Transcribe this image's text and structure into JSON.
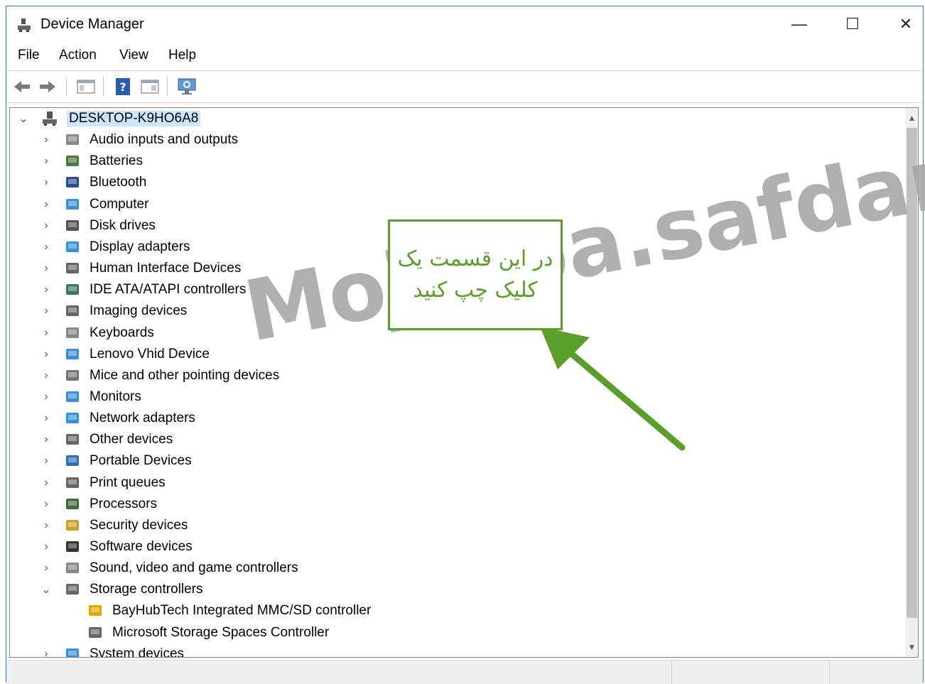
{
  "window": {
    "title": "Device Manager",
    "controls": {
      "minimize": "—",
      "maximize": "☐",
      "close": "✕"
    }
  },
  "menu": [
    "File",
    "Action",
    "View",
    "Help"
  ],
  "toolbar": {
    "buttons": [
      "back-icon",
      "forward-icon",
      "properties-pane-icon",
      "help-icon",
      "update-driver-icon",
      "scan-hardware-icon"
    ]
  },
  "tree": {
    "root": "DESKTOP-K9HO6A8",
    "categories": [
      {
        "label": "Audio inputs and outputs",
        "icon": "speaker-icon",
        "expanded": false
      },
      {
        "label": "Batteries",
        "icon": "battery-icon",
        "expanded": false
      },
      {
        "label": "Bluetooth",
        "icon": "bluetooth-icon",
        "expanded": false
      },
      {
        "label": "Computer",
        "icon": "computer-icon",
        "expanded": false
      },
      {
        "label": "Disk drives",
        "icon": "disk-drive-icon",
        "expanded": false
      },
      {
        "label": "Display adapters",
        "icon": "display-adapter-icon",
        "expanded": false
      },
      {
        "label": "Human Interface Devices",
        "icon": "hid-icon",
        "expanded": false
      },
      {
        "label": "IDE ATA/ATAPI controllers",
        "icon": "ide-controller-icon",
        "expanded": false
      },
      {
        "label": "Imaging devices",
        "icon": "camera-icon",
        "expanded": false
      },
      {
        "label": "Keyboards",
        "icon": "keyboard-icon",
        "expanded": false
      },
      {
        "label": "Lenovo Vhid Device",
        "icon": "network-computer-icon",
        "expanded": false
      },
      {
        "label": "Mice and other pointing devices",
        "icon": "mouse-icon",
        "expanded": false
      },
      {
        "label": "Monitors",
        "icon": "monitor-icon",
        "expanded": false
      },
      {
        "label": "Network adapters",
        "icon": "network-adapter-icon",
        "expanded": false
      },
      {
        "label": "Other devices",
        "icon": "unknown-device-icon",
        "expanded": false
      },
      {
        "label": "Portable Devices",
        "icon": "portable-device-icon",
        "expanded": false
      },
      {
        "label": "Print queues",
        "icon": "printer-icon",
        "expanded": false
      },
      {
        "label": "Processors",
        "icon": "processor-icon",
        "expanded": false
      },
      {
        "label": "Security devices",
        "icon": "security-key-icon",
        "expanded": false
      },
      {
        "label": "Software devices",
        "icon": "software-device-icon",
        "expanded": false
      },
      {
        "label": "Sound, video and game controllers",
        "icon": "speaker-icon",
        "expanded": false
      },
      {
        "label": "Storage controllers",
        "icon": "storage-controller-icon",
        "expanded": true,
        "children": [
          {
            "label": "BayHubTech Integrated MMC/SD controller",
            "icon": "storage-warning-icon"
          },
          {
            "label": "Microsoft Storage Spaces Controller",
            "icon": "storage-controller-icon"
          }
        ]
      },
      {
        "label": "System devices",
        "icon": "system-device-icon",
        "expanded": false
      }
    ]
  },
  "annotation": {
    "callout_text": "در این قسمت یک کلیک چپ کنید",
    "watermark": "Mojtaba.safdari.n",
    "color": "#5a9e2c"
  }
}
